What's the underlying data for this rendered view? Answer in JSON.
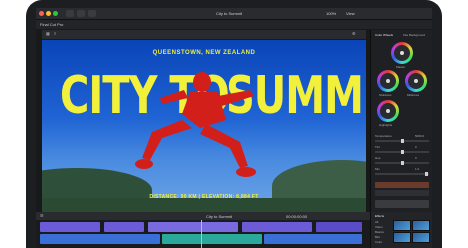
{
  "window": {
    "library_label": "Final Cut Pro",
    "project_title": "City to Summit",
    "zoom_label": "100%",
    "view_label": "View",
    "inspector_title": "Color Wheels",
    "inspector_tag": "Kite Background"
  },
  "viewer": {
    "location_caption": "QUEENSTOWN, NEW ZEALAND",
    "title_left": "CITY TO",
    "title_right": "SUMMIT",
    "stats_caption": "DISTANCE: 90 KM | ELEVATION: 8,884 FT"
  },
  "inspector": {
    "wheels": [
      "Master",
      "Shadows",
      "Midtones",
      "Highlights"
    ],
    "params": [
      "Temperature",
      "Tint",
      "Hue",
      "Mix"
    ],
    "param_values": [
      "5000.0",
      "0",
      "0",
      "1.0"
    ]
  },
  "timeline": {
    "project_label": "City to Summit",
    "timecode": "00:00:00:00"
  },
  "effects": {
    "title": "Effects",
    "categories": [
      "All",
      "Video",
      "Basics",
      "Blur",
      "Color"
    ]
  },
  "colors": {
    "viewer_sky": "#1f63d4",
    "title_yellow": "#f2f03a",
    "runner_red": "#d21f1a",
    "clip_purple": "#6b5bd6",
    "clip_blue": "#3b6fd8",
    "clip_teal": "#2aa89a"
  }
}
